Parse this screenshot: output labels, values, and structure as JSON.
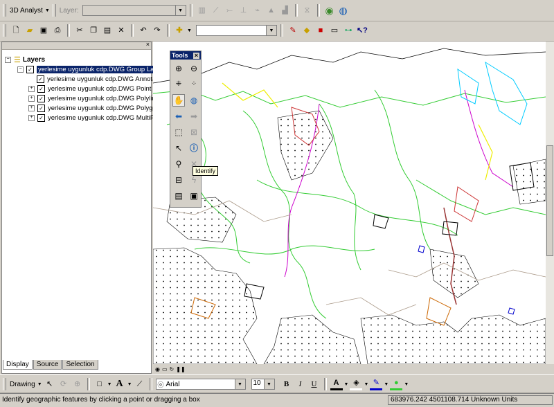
{
  "toolbar3d": {
    "analyst_label": "3D Analyst",
    "layer_label": "Layer:"
  },
  "standard_toolbar": {
    "scale_value": ""
  },
  "toc": {
    "root_label": "Layers",
    "group_layer": "yerlesime uygunluk cdp.DWG Group Layer",
    "layers": [
      "yerlesime uygunluk cdp.DWG Annotatio",
      "yerlesime uygunluk cdp.DWG Point",
      "yerlesime uygunluk cdp.DWG Polyline",
      "yerlesime uygunluk cdp.DWG Polygon",
      "yerlesime uygunluk cdp.DWG MultiPatc"
    ],
    "tabs": [
      "Display",
      "Source",
      "Selection"
    ]
  },
  "tools_window": {
    "title": "Tools",
    "close": "×",
    "tooltip": "Identify"
  },
  "drawing_toolbar": {
    "drawing_label": "Drawing",
    "font_name": "Arial",
    "font_size": "10",
    "bold": "B",
    "italic": "I",
    "underline": "U",
    "font_color_label": "A"
  },
  "status_bar": {
    "message": "Identify geographic features by clicking a point or dragging a box",
    "coordinates": "683976.242  4501108.714 Unknown Units"
  },
  "colors": {
    "chrome": "#d4d0c8",
    "title_active": "#0a246a",
    "selection": "#0a246a"
  }
}
